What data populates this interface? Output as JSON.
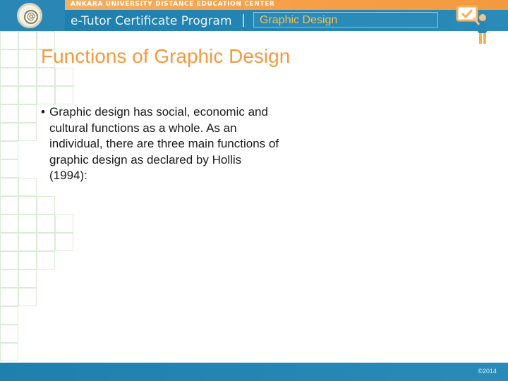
{
  "header": {
    "university": "ANKARA UNIVERSITY DISTANCE EDUCATION CENTER",
    "program": "e-Tutor Certificate Program",
    "course": "Graphic Design",
    "logo_icon": "university-seal-icon",
    "teacher_icon": "teacher-board-icon"
  },
  "slide": {
    "title": "Functions of Graphic Design",
    "bullets": [
      "Graphic design has social, economic and cultural functions as a whole. As an individual, there are three main functions of graphic design as declared by Hollis (1994):"
    ]
  },
  "footer": {
    "copyright": "©2014"
  },
  "colors": {
    "accent_orange": "#f39a3e",
    "brand_blue": "#2a8ab8",
    "course_yellow": "#f7c04d",
    "grid_green": "#d8ecd6"
  }
}
